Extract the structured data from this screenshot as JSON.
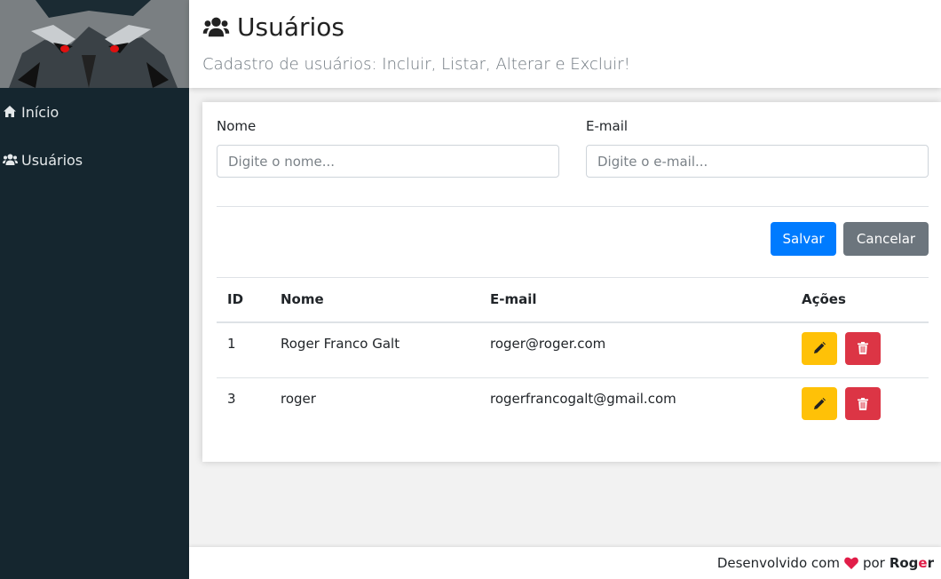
{
  "sidebar": {
    "logo_icon": "wolf-logo",
    "items": [
      {
        "label": "Início",
        "icon": "home-icon"
      },
      {
        "label": "Usuários",
        "icon": "users-icon"
      }
    ]
  },
  "header": {
    "title": "Usuários",
    "title_icon": "users-icon",
    "subtitle": "Cadastro de usuários: Incluir, Listar, Alterar e Excluir!"
  },
  "form": {
    "nome_label": "Nome",
    "nome_placeholder": "Digite o nome...",
    "nome_value": "",
    "email_label": "E-mail",
    "email_placeholder": "Digite o e-mail...",
    "email_value": "",
    "save_label": "Salvar",
    "cancel_label": "Cancelar"
  },
  "table": {
    "headers": {
      "id": "ID",
      "nome": "Nome",
      "email": "E-mail",
      "acoes": "Ações"
    },
    "rows": [
      {
        "id": "1",
        "nome": "Roger Franco Galt",
        "email": "roger@roger.com"
      },
      {
        "id": "3",
        "nome": "roger",
        "email": "rogerfrancogalt@gmail.com"
      }
    ],
    "edit_icon": "pencil-icon",
    "delete_icon": "trash-icon"
  },
  "footer": {
    "prefix": "Desenvolvido com",
    "heart_icon": "heart-icon",
    "by": "por",
    "author_a": "Rog",
    "author_b": "e",
    "author_c": "r"
  },
  "colors": {
    "sidebar_bg": "#15262f",
    "primary": "#007bff",
    "secondary": "#6c757d",
    "warning": "#ffc107",
    "danger": "#dc3545",
    "heart": "#e11d48"
  }
}
